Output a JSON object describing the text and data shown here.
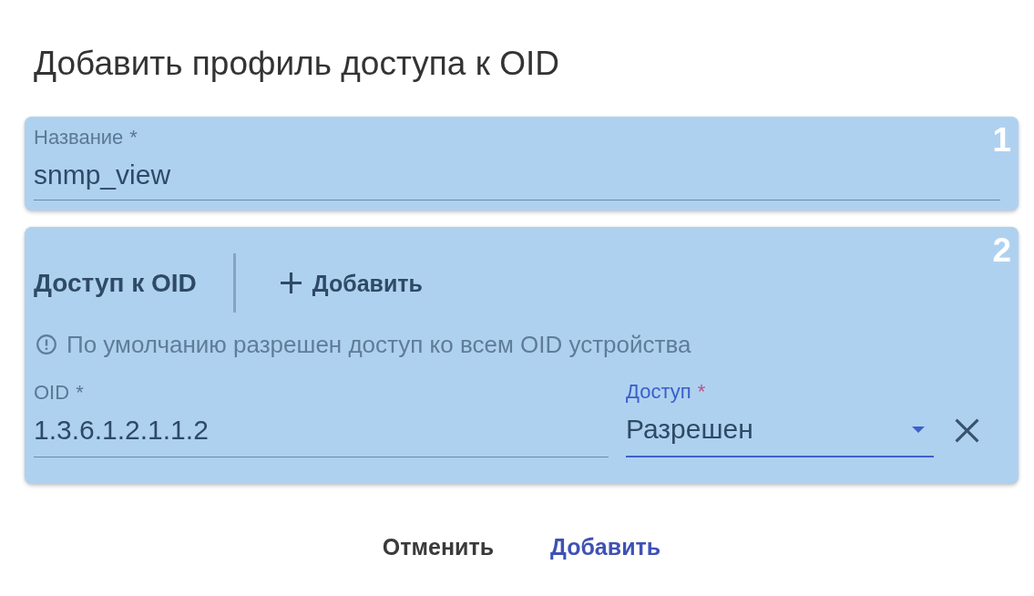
{
  "dialog": {
    "title": "Добавить профиль доступа к OID"
  },
  "name_section": {
    "badge": "1",
    "field": {
      "label": "Название",
      "required_mark": "*",
      "value": "snmp_view",
      "focused": false
    }
  },
  "oid_section": {
    "badge": "2",
    "heading": "Доступ к OID",
    "add_button": {
      "label": "Добавить"
    },
    "info": "По умолчанию разрешен доступ ко всем OID устройства",
    "rows": [
      {
        "oid": {
          "label": "OID",
          "required_mark": "*",
          "value": "1.3.6.1.2.1.1.2",
          "focused": false
        },
        "access": {
          "label": "Доступ",
          "required_mark": "*",
          "value": "Разрешен",
          "focused": true
        }
      }
    ]
  },
  "actions": [
    {
      "label": "Отменить",
      "kind": "secondary"
    },
    {
      "label": "Добавить",
      "kind": "primary"
    }
  ]
}
